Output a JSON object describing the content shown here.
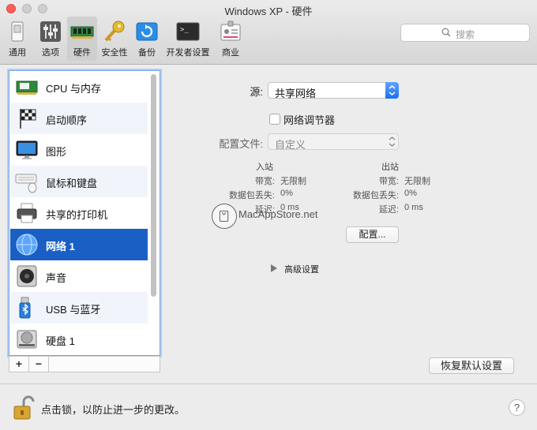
{
  "window": {
    "title": "Windows XP - 硬件"
  },
  "toolbar": {
    "items": [
      {
        "label": "通用",
        "icon": "general-icon"
      },
      {
        "label": "选项",
        "icon": "options-sliders-icon"
      },
      {
        "label": "硬件",
        "icon": "memory-chip-icon",
        "active": true
      },
      {
        "label": "安全性",
        "icon": "key-icon"
      },
      {
        "label": "备份",
        "icon": "backup-icon"
      },
      {
        "label": "开发者设置",
        "icon": "terminal-icon"
      },
      {
        "label": "商业",
        "icon": "id-badge-icon"
      }
    ],
    "search_placeholder": "搜索"
  },
  "sidebar": {
    "items": [
      {
        "label": "CPU 与内存",
        "icon": "cpu-memory-icon"
      },
      {
        "label": "启动顺序",
        "icon": "boot-order-flag-icon"
      },
      {
        "label": "图形",
        "icon": "monitor-icon"
      },
      {
        "label": "鼠标和键盘",
        "icon": "keyboard-mouse-icon"
      },
      {
        "label": "共享的打印机",
        "icon": "printer-icon"
      },
      {
        "label": "网络 1",
        "icon": "network-globe-icon",
        "selected": true
      },
      {
        "label": "声音",
        "icon": "speaker-icon"
      },
      {
        "label": "USB 与蓝牙",
        "icon": "usb-bluetooth-icon"
      },
      {
        "label": "硬盘 1",
        "icon": "hard-disk-icon"
      }
    ],
    "add_label": "+",
    "remove_label": "−"
  },
  "network": {
    "source_label": "源:",
    "source_value": "共享网络",
    "conditioner_label": "网络调节器",
    "conditioner_checked": false,
    "profile_label": "配置文件:",
    "profile_value": "自定义",
    "inbound_header": "入站",
    "outbound_header": "出站",
    "bandwidth_label": "带宽:",
    "loss_label": "数据包丢失:",
    "delay_label": "延迟:",
    "inbound": {
      "bandwidth": "无限制",
      "loss": "0%",
      "delay": "0 ms"
    },
    "outbound": {
      "bandwidth": "无限制",
      "loss": "0%",
      "delay": "0 ms"
    },
    "configure_button": "配置...",
    "advanced_label": "高级设置",
    "restore_button": "恢复默认设置"
  },
  "watermark": {
    "text": "MacAppStore.net"
  },
  "footer": {
    "lock_text": "点击锁，以防止进一步的更改。",
    "help_label": "?"
  },
  "colors": {
    "selection": "#1a5fc4",
    "accent": "#1b6ff0",
    "close": "#fc5f57"
  }
}
